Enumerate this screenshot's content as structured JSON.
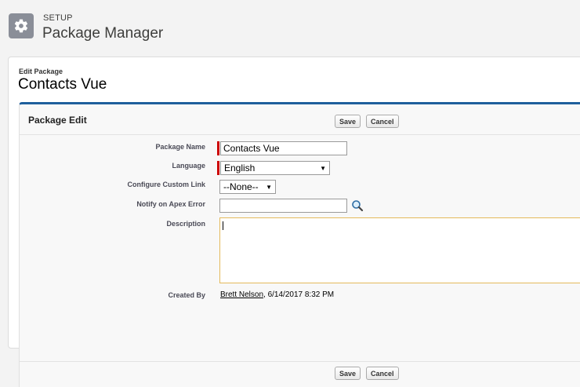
{
  "setup": {
    "label": "SETUP",
    "title": "Package Manager",
    "icon": "gear-icon"
  },
  "record": {
    "edit_label": "Edit Package",
    "title": "Contacts Vue"
  },
  "block": {
    "title": "Package Edit",
    "save_label": "Save",
    "cancel_label": "Cancel"
  },
  "form": {
    "package_name": {
      "label": "Package Name",
      "value": "Contacts Vue"
    },
    "language": {
      "label": "Language",
      "value": "English"
    },
    "custom_link": {
      "label": "Configure Custom Link",
      "value": "--None--"
    },
    "notify": {
      "label": "Notify on Apex Error",
      "value": ""
    },
    "description": {
      "label": "Description",
      "value": ""
    },
    "created_by": {
      "label": "Created By",
      "user": "Brett Nelson",
      "date": ", 6/14/2017 8:32 PM"
    }
  },
  "colors": {
    "accent": "#1e5f9c",
    "required": "#cc0000",
    "focus_border": "#e4b95b"
  }
}
